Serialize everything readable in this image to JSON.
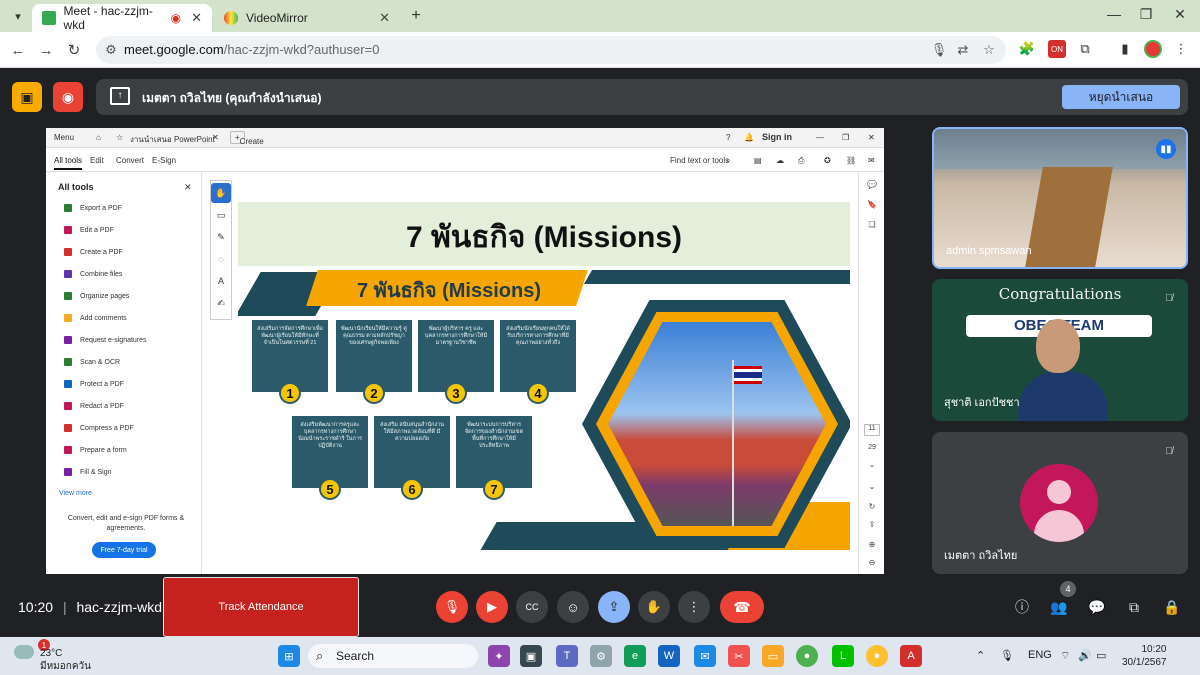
{
  "browser": {
    "tabs": [
      {
        "title": "Meet - hac-zzjm-wkd",
        "active": true
      },
      {
        "title": "VideoMirror",
        "active": false
      }
    ],
    "url_host": "meet.google.com",
    "url_path": "/hac-zzjm-wkd?authuser=0"
  },
  "meet": {
    "presenting_text": "เมตตา ถวิลไทย (คุณกำลังนำเสนอ)",
    "stop_presenting_label": "หยุดนำเสนอ",
    "meeting_time": "10:20",
    "meeting_code": "hac-zzjm-wkd",
    "track_attendance_label": "Track Attendance",
    "people_count": "4"
  },
  "acrobat": {
    "top": {
      "menu": "Menu",
      "tab": "งานนำเสนอ PowerPoint",
      "create": "Create",
      "signin": "Sign in"
    },
    "menu_tabs": [
      "All tools",
      "Edit",
      "Convert",
      "E-Sign"
    ],
    "find_text": "Find text or tools",
    "sidebar_title": "All tools",
    "tools": [
      {
        "label": "Export a PDF",
        "color": "#2e7d32"
      },
      {
        "label": "Edit a PDF",
        "color": "#c2185b"
      },
      {
        "label": "Create a PDF",
        "color": "#d32f2f"
      },
      {
        "label": "Combine files",
        "color": "#5e35b1"
      },
      {
        "label": "Organize pages",
        "color": "#2e7d32"
      },
      {
        "label": "Add comments",
        "color": "#f9a825"
      },
      {
        "label": "Request e-signatures",
        "color": "#7b1fa2"
      },
      {
        "label": "Scan & OCR",
        "color": "#2e7d32"
      },
      {
        "label": "Protect a PDF",
        "color": "#1565c0"
      },
      {
        "label": "Redact a PDF",
        "color": "#c2185b"
      },
      {
        "label": "Compress a PDF",
        "color": "#d32f2f"
      },
      {
        "label": "Prepare a form",
        "color": "#c2185b"
      },
      {
        "label": "Fill & Sign",
        "color": "#7b1fa2"
      }
    ],
    "view_more": "View more",
    "promo": "Convert, edit and e-sign PDF forms & agreements.",
    "trial_label": "Free 7-day trial",
    "page_current": "11",
    "page_total": "29"
  },
  "slide": {
    "title": "7 พันธกิจ (Missions)",
    "ribbon": "7 พันธกิจ (Missions)",
    "missions": [
      {
        "n": "1",
        "text": "ส่งเสริมการจัดการศึกษาเพื่อพัฒนาผู้เรียนให้มีทักษะที่จำเป็นในศตวรรษที่ 21"
      },
      {
        "n": "2",
        "text": "พัฒนานักเรียนให้มีความรู้ คู่คุณธรรม ตามหลักปรัชญาของเศรษฐกิจพอเพียง"
      },
      {
        "n": "3",
        "text": "พัฒนาผู้บริหาร ครู และบุคลากรทางการศึกษาให้มีมาตรฐานวิชาชีพ"
      },
      {
        "n": "4",
        "text": "ส่งเสริมนักเรียนทุกคนให้ได้รับบริการทางการศึกษาที่มีคุณภาพอย่างทั่วถึง"
      },
      {
        "n": "5",
        "text": "ส่งเสริมพัฒนาการครูและบุคลากรทางการศึกษา น้อมนำพระราชดำริ ในการปฏิบัติงาน"
      },
      {
        "n": "6",
        "text": "ส่งเสริม สนับสนุนสำนักงานให้มีสภาพแวดล้อมที่ดี มีความปลอดภัย"
      },
      {
        "n": "7",
        "text": "พัฒนาระบบการบริหารจัดการของสำนักงานเขตพื้นที่การศึกษาให้มีประสิทธิภาพ"
      }
    ]
  },
  "participants": [
    {
      "name": "admin spmsawan",
      "state": "speaking"
    },
    {
      "name": "สุชาติ เอกปัชชา",
      "state": "muted",
      "banner": "Congratulations",
      "banner2": "OBEC TEAM"
    },
    {
      "name": "เมตตา ถวิลไทย",
      "state": "muted"
    }
  ],
  "taskbar": {
    "weather_temp": "23°C",
    "weather_desc": "มีหมอกควัน",
    "weather_badge": "1",
    "search_label": "Search",
    "lang": "ENG",
    "time": "10:20",
    "date": "30/1/2567"
  }
}
